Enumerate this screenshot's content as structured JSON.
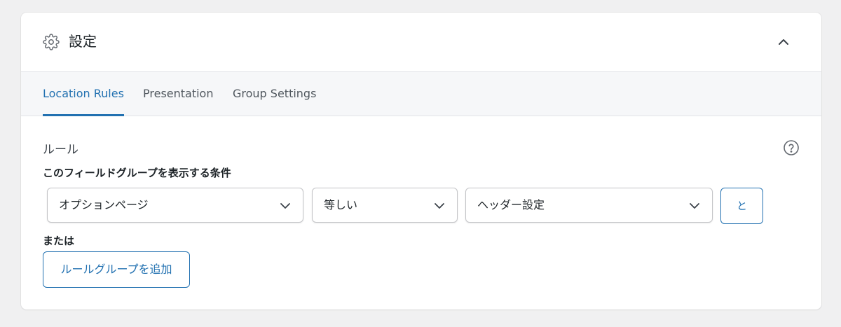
{
  "panel": {
    "title": "設定",
    "icon": "gear-icon",
    "collapse_icon": "chevron-up-icon"
  },
  "tabs": [
    {
      "label": "Location Rules",
      "active": true
    },
    {
      "label": "Presentation",
      "active": false
    },
    {
      "label": "Group Settings",
      "active": false
    }
  ],
  "rules": {
    "label": "ルール",
    "help_icon": "help-circle-icon",
    "condition_heading": "このフィールドグループを表示する条件",
    "param_value": "オプションページ",
    "operator_value": "等しい",
    "value_value": "ヘッダー設定",
    "and_label": "と",
    "or_label": "または",
    "add_group_label": "ルールグループを追加"
  },
  "colors": {
    "accent": "#2271b1",
    "background": "#f0f0f1",
    "panel": "#ffffff",
    "tabs_bar": "#f6f7f9"
  }
}
